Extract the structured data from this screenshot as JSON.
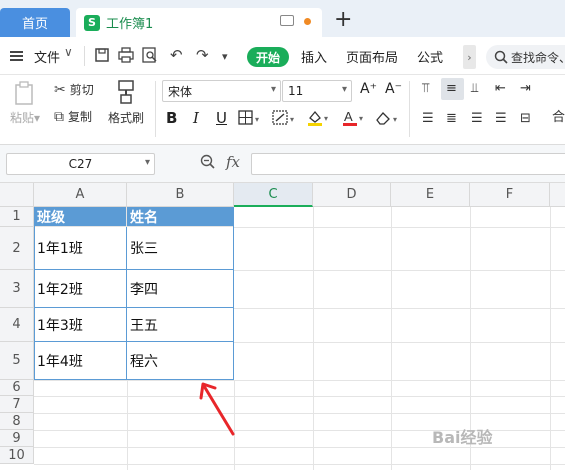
{
  "tabs": {
    "home": "首页",
    "doc_icon": "S",
    "doc_title": "工作簿1",
    "add": "+"
  },
  "menubar": {
    "file_label": "文件",
    "chevron": "∨",
    "start_label": "开始",
    "items": [
      "插入",
      "页面布局",
      "公式"
    ],
    "more_arrow": "›",
    "search_placeholder": "查找命令、"
  },
  "ribbon": {
    "paste_label": "粘贴",
    "cut_label": "剪切",
    "copy_label": "复制",
    "format_painter_label": "格式刷",
    "font_name": "宋体",
    "font_size": "11",
    "bold": "B",
    "italic": "I",
    "underline": "U",
    "font_grow": "A⁺",
    "font_shrink": "A⁻",
    "merge_label": "合"
  },
  "formula_bar": {
    "cell_ref": "C27",
    "fx": "fx",
    "value": ""
  },
  "sheet": {
    "columns": [
      "A",
      "B",
      "C",
      "D",
      "E",
      "F"
    ],
    "active_column": "C",
    "rows": [
      "1",
      "2",
      "3",
      "4",
      "5",
      "6",
      "7",
      "8",
      "9",
      "10"
    ],
    "header_row": {
      "a": "班级",
      "b": "姓名"
    },
    "data_rows": [
      {
        "a": "1年1班",
        "b": "张三"
      },
      {
        "a": "1年2班",
        "b": "李四"
      },
      {
        "a": "1年3班",
        "b": "王五"
      },
      {
        "a": "1年4班",
        "b": "程六"
      }
    ]
  },
  "colors": {
    "accent": "#1aad5a",
    "home_tab": "#4a8fe0",
    "table_header": "#5b9bd5",
    "arrow": "#e8262a"
  },
  "watermark": "Bai经验"
}
